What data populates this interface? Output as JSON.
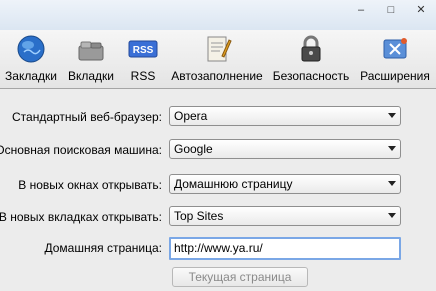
{
  "window": {
    "controls": [
      "–",
      "□",
      "✕"
    ]
  },
  "toolbar": {
    "items": [
      {
        "label": "Закладки",
        "icon": "globe-icon"
      },
      {
        "label": "Вкладки",
        "icon": "tabs-icon"
      },
      {
        "label": "RSS",
        "icon": "rss-icon"
      },
      {
        "label": "Автозаполнение",
        "icon": "autofill-icon"
      },
      {
        "label": "Безопасность",
        "icon": "lock-icon"
      },
      {
        "label": "Расширения",
        "icon": "extensions-icon"
      }
    ],
    "rss_badge": "RSS"
  },
  "form": {
    "default_browser": {
      "label": "Стандартный веб-браузер:",
      "value": "Opera"
    },
    "search_engine": {
      "label": "Основная поисковая машина:",
      "value": "Google"
    },
    "new_windows": {
      "label": "В новых окнах открывать:",
      "value": "Домашнюю страницу"
    },
    "new_tabs": {
      "label": "В новых вкладках открывать:",
      "value": "Top Sites"
    },
    "homepage": {
      "label": "Домашняя страница:",
      "value": "http://www.ya.ru/"
    },
    "current_page_button": "Текущая страница"
  },
  "colors": {
    "focus_ring": "#7aa7e6",
    "disabled_text": "#8a8a8a"
  }
}
